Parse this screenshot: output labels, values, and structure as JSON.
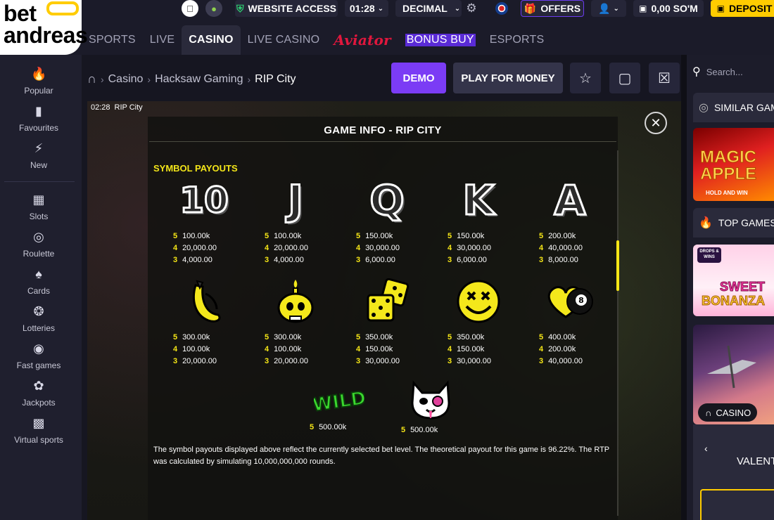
{
  "brand": {
    "logo_line1": "bet",
    "logo_line2": "andreas"
  },
  "topbar": {
    "website_access": "WEBSITE ACCESS",
    "time": "01:28",
    "odds_format": "DECIMAL",
    "offers": "OFFERS",
    "balance": "0,00 SO'M",
    "deposit": "DEPOSIT"
  },
  "nav": [
    "SPORTS",
    "LIVE",
    "CASINO",
    "LIVE CASINO",
    "Aviator",
    "BONUS BUY",
    "ESPORTS"
  ],
  "sidebar": [
    {
      "label": "Popular",
      "icon": "fire-icon"
    },
    {
      "label": "Favourites",
      "icon": "bookmark-icon"
    },
    {
      "label": "New",
      "icon": "lightning-icon"
    },
    {
      "label": "Slots",
      "icon": "slots-icon"
    },
    {
      "label": "Roulette",
      "icon": "roulette-icon"
    },
    {
      "label": "Cards",
      "icon": "cards-icon"
    },
    {
      "label": "Lotteries",
      "icon": "lottery-icon"
    },
    {
      "label": "Fast games",
      "icon": "fast-games-icon"
    },
    {
      "label": "Jackpots",
      "icon": "jackpot-icon"
    },
    {
      "label": "Virtual sports",
      "icon": "virtual-sports-icon"
    }
  ],
  "breadcrumb": [
    "Casino",
    "Hacksaw Gaming",
    "RIP City"
  ],
  "buttons": {
    "demo": "DEMO",
    "play": "PLAY FOR MONEY"
  },
  "game": {
    "clock": "02:28",
    "name": "RIP City",
    "dialog_title": "GAME INFO - RIP CITY",
    "section_title": "SYMBOL PAYOUTS",
    "symbols_row1": [
      {
        "glyph": "10",
        "pays": [
          [
            "5",
            "100.00k"
          ],
          [
            "4",
            "20,000.00"
          ],
          [
            "3",
            "4,000.00"
          ]
        ]
      },
      {
        "glyph": "J",
        "pays": [
          [
            "5",
            "100.00k"
          ],
          [
            "4",
            "20,000.00"
          ],
          [
            "3",
            "4,000.00"
          ]
        ]
      },
      {
        "glyph": "Q",
        "pays": [
          [
            "5",
            "150.00k"
          ],
          [
            "4",
            "30,000.00"
          ],
          [
            "3",
            "6,000.00"
          ]
        ]
      },
      {
        "glyph": "K",
        "pays": [
          [
            "5",
            "150.00k"
          ],
          [
            "4",
            "30,000.00"
          ],
          [
            "3",
            "6,000.00"
          ]
        ]
      },
      {
        "glyph": "A",
        "pays": [
          [
            "5",
            "200.00k"
          ],
          [
            "4",
            "40,000.00"
          ],
          [
            "3",
            "8,000.00"
          ]
        ]
      }
    ],
    "symbols_row2": [
      {
        "name": "banana",
        "pays": [
          [
            "5",
            "300.00k"
          ],
          [
            "4",
            "100.00k"
          ],
          [
            "3",
            "20,000.00"
          ]
        ]
      },
      {
        "name": "skull-candle",
        "pays": [
          [
            "5",
            "300.00k"
          ],
          [
            "4",
            "100.00k"
          ],
          [
            "3",
            "20,000.00"
          ]
        ]
      },
      {
        "name": "dice",
        "pays": [
          [
            "5",
            "350.00k"
          ],
          [
            "4",
            "150.00k"
          ],
          [
            "3",
            "30,000.00"
          ]
        ]
      },
      {
        "name": "smiley",
        "pays": [
          [
            "5",
            "350.00k"
          ],
          [
            "4",
            "150.00k"
          ],
          [
            "3",
            "30,000.00"
          ]
        ]
      },
      {
        "name": "heart-8ball",
        "pays": [
          [
            "5",
            "400.00k"
          ],
          [
            "4",
            "200.00k"
          ],
          [
            "3",
            "40,000.00"
          ]
        ]
      }
    ],
    "special": [
      {
        "name": "wild",
        "glyph": "WILD",
        "pays": [
          [
            "5",
            "500.00k"
          ]
        ]
      },
      {
        "name": "cat",
        "pays": [
          [
            "5",
            "500.00k"
          ]
        ]
      }
    ],
    "rtp_text": "The symbol payouts displayed above reflect the currently selected bet level. The theoretical payout for this game is 96.22%. The RTP was calculated by simulating 10,000,000,000 rounds."
  },
  "right_panel": {
    "search_placeholder": "Search...",
    "similar": "SIMILAR GAMES",
    "top": "TOP GAMES",
    "casino_tag": "CASINO",
    "valent": "VALENT",
    "card1_line1": "MAGIC",
    "card1_line2": "APPLE",
    "card1_line3": "HOLD AND WIN",
    "card2_badge": "DROPS & WINS",
    "card2_line1": "SWEET",
    "card2_line2": "BONANZA"
  },
  "colors": {
    "accent_yellow": "#f5e616",
    "demo_purple": "#7b3cf5",
    "deposit_yellow": "#ffcc00"
  }
}
